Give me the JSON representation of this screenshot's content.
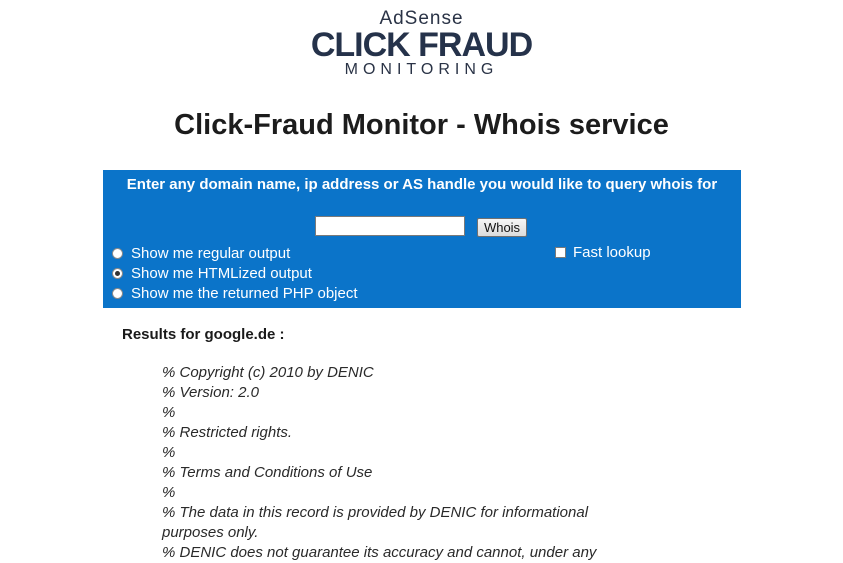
{
  "logo": {
    "top_text": "AdSense",
    "main_text": "CLICK FRAUD",
    "sub_text": "MONITORING"
  },
  "page_title": "Click-Fraud Monitor - Whois service",
  "query": {
    "prompt": "Enter any domain name, ip address or AS handle you would like to query whois for",
    "input_value": "",
    "submit_label": "Whois",
    "options": [
      {
        "label": "Show me regular output",
        "checked": false
      },
      {
        "label": "Show me HTMLized output",
        "checked": true
      },
      {
        "label": "Show me the returned PHP object",
        "checked": false
      }
    ],
    "fast_lookup_label": "Fast lookup",
    "fast_lookup_checked": false
  },
  "results": {
    "title": "Results for google.de :",
    "lines": [
      "% Copyright (c) 2010 by DENIC",
      "% Version: 2.0",
      "%",
      "% Restricted rights.",
      "%",
      "% Terms and Conditions of Use",
      "%",
      "% The data in this record is provided by DENIC for informational",
      "purposes only.",
      "% DENIC does not guarantee its accuracy and cannot, under any"
    ]
  },
  "colors": {
    "query_box_bg": "#0b74c9",
    "logo_text": "#25324a"
  }
}
